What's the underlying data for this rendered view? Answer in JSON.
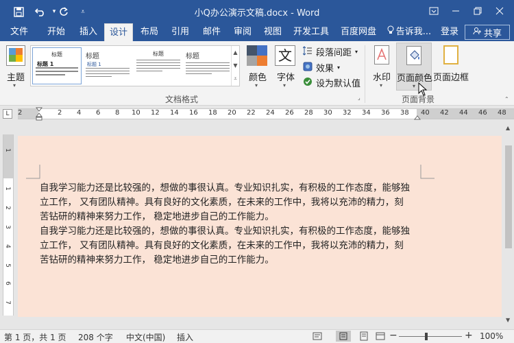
{
  "window": {
    "title": "小Q办公演示文稿.docx - Word"
  },
  "tabs": [
    {
      "label": "文件"
    },
    {
      "label": "开始"
    },
    {
      "label": "插入"
    },
    {
      "label": "设计"
    },
    {
      "label": "布局"
    },
    {
      "label": "引用"
    },
    {
      "label": "邮件"
    },
    {
      "label": "审阅"
    },
    {
      "label": "视图"
    },
    {
      "label": "开发工具"
    },
    {
      "label": "百度网盘"
    }
  ],
  "tell_me": "告诉我...",
  "login": "登录",
  "share": "共享",
  "ribbon": {
    "theme_label": "主题",
    "gallery": {
      "thumb1_title": "标题",
      "thumb1_heading": "标题 1",
      "thumb2_title": "标题",
      "thumb2_heading": "标题 1",
      "thumb3_title": "标题",
      "thumb4_title": "标题"
    },
    "colors_label": "颜色",
    "fonts_label": "字体",
    "font_glyph": "文",
    "paragraph_spacing": "段落间距",
    "effects": "效果",
    "set_default": "设为默认值",
    "group_document_format": "文档格式",
    "watermark": "水印",
    "page_color": "页面颜色",
    "page_borders": "页面边框",
    "group_page_background": "页面背景"
  },
  "ruler": {
    "numbers": [
      "2",
      "2",
      "4",
      "6",
      "8",
      "10",
      "12",
      "14",
      "16",
      "18",
      "20",
      "22",
      "24",
      "26",
      "28",
      "30",
      "32",
      "34",
      "36",
      "38",
      "40",
      "42",
      "44",
      "46",
      "48"
    ],
    "vnumbers": [
      "1",
      "1",
      "2",
      "3",
      "4",
      "5",
      "6",
      "7",
      "8"
    ]
  },
  "document": {
    "paragraphs": [
      "自我学习能力还是比较强的，想做的事很认真。专业知识扎实，有积极的工作态度，能够独",
      "立工作，  又有团队精神。具有良好的文化素质，在未来的工作中，我将以充沛的精力，刻",
      "苦钻研的精神来努力工作，  稳定地进步自己的工作能力。",
      "自我学习能力还是比较强的，想做的事很认真。专业知识扎实，有积极的工作态度，能够独",
      "立工作，  又有团队精神。具有良好的文化素质，在未来的工作中，我将以充沛的精力，刻",
      "苦钻研的精神来努力工作，  稳定地进步自己的工作能力。"
    ]
  },
  "status": {
    "page": "第 1 页，共 1 页",
    "words": "208 个字",
    "language": "中文(中国)",
    "mode": "插入",
    "zoom": "100%",
    "zoom_minus": "−",
    "zoom_plus": "+"
  },
  "colors": {
    "accent": "#2b579a",
    "page_bg": "#fbe3d6"
  }
}
